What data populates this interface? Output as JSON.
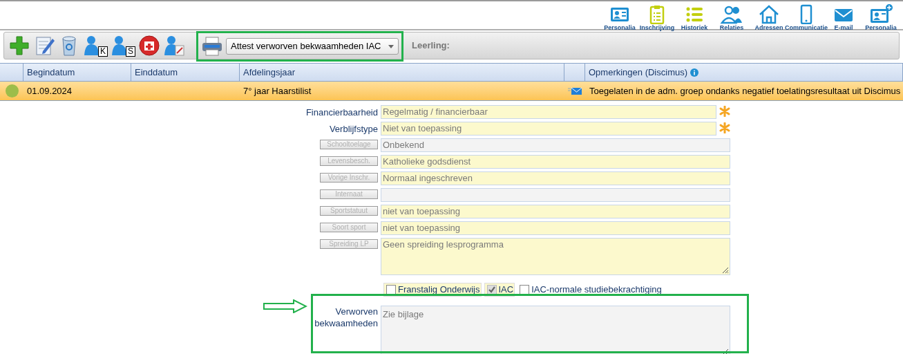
{
  "nav": [
    {
      "label": "Personalia",
      "kind": "card",
      "color": "#1f8fd1"
    },
    {
      "label": "Inschrijving",
      "kind": "clipboard",
      "color": "#c2cf0f"
    },
    {
      "label": "Historiek",
      "kind": "list",
      "color": "#c2cf0f"
    },
    {
      "label": "Relaties",
      "kind": "people",
      "color": "#1f8fd1"
    },
    {
      "label": "Adressen",
      "kind": "house",
      "color": "#1f8fd1"
    },
    {
      "label": "Communicatie",
      "kind": "phone",
      "color": "#1f8fd1"
    },
    {
      "label": "E-mail",
      "kind": "mail",
      "color": "#1f8fd1"
    },
    {
      "label": "Personalia",
      "kind": "card-plus",
      "color": "#1f8fd1"
    }
  ],
  "toolbar": {
    "tools": [
      {
        "kind": "add"
      },
      {
        "kind": "edit"
      },
      {
        "kind": "bin"
      },
      {
        "kind": "person",
        "badge": "K"
      },
      {
        "kind": "person",
        "badge": "S"
      },
      {
        "kind": "hospital"
      },
      {
        "kind": "person-edit"
      }
    ],
    "report": "Attest verworven bekwaamheden IAC",
    "student_label": "Leerling:"
  },
  "table": {
    "columns": [
      "Begindatum",
      "Einddatum",
      "Afdelingsjaar",
      "Opmerkingen (Discimus)"
    ],
    "rows": [
      {
        "color": "#9dbd4a",
        "selected": true,
        "cells": [
          "01.09.2024",
          "",
          "7° jaar Haarstilist"
        ],
        "has_mail": true,
        "remark": "Toegelaten in de adm. groep ondanks negatief toelatingsresultaat uit Discimus"
      }
    ]
  },
  "form": {
    "fields": [
      {
        "kind": "label",
        "label": "Financierbaarheid",
        "value": "Regelmatig / financierbaar",
        "disabled": false,
        "required": true
      },
      {
        "kind": "label",
        "label": "Verblijfstype",
        "value": "Niet van toepassing",
        "disabled": false,
        "required": true
      },
      {
        "kind": "button",
        "label": "Schooltoelage",
        "value": "Onbekend",
        "disabled": true,
        "required": false
      },
      {
        "kind": "button",
        "label": "Levensbesch.",
        "value": "Katholieke godsdienst",
        "disabled": false,
        "required": false
      },
      {
        "kind": "button",
        "label": "Vorige Inschr.",
        "value": "Normaal ingeschreven",
        "disabled": false,
        "required": false
      },
      {
        "kind": "button",
        "label": "Internaat",
        "disabled": true,
        "required": false
      },
      {
        "kind": "button",
        "label": "Sportstatuut",
        "value": "niet van toepassing",
        "disabled": false,
        "required": false
      },
      {
        "kind": "button",
        "label": "Soort sport",
        "value": "niet van toepassing",
        "disabled": false,
        "required": false
      },
      {
        "kind": "button-area",
        "label": "Spreiding LP",
        "value": "Geen spreiding lesprogramma",
        "disabled": false,
        "required": false
      }
    ],
    "checkboxes": [
      {
        "label": "Franstalig Onderwijs",
        "checked": false,
        "disabled": false,
        "highlighted": true
      },
      {
        "label": "IAC",
        "checked": true,
        "disabled": true,
        "highlighted": true
      },
      {
        "label": "IAC-normale studiebekrachtiging",
        "checked": false,
        "disabled": false,
        "highlighted": false
      }
    ],
    "competences": {
      "label": "Verworven bekwaamheden",
      "value": "Zie bijlage",
      "disabled": true
    }
  }
}
